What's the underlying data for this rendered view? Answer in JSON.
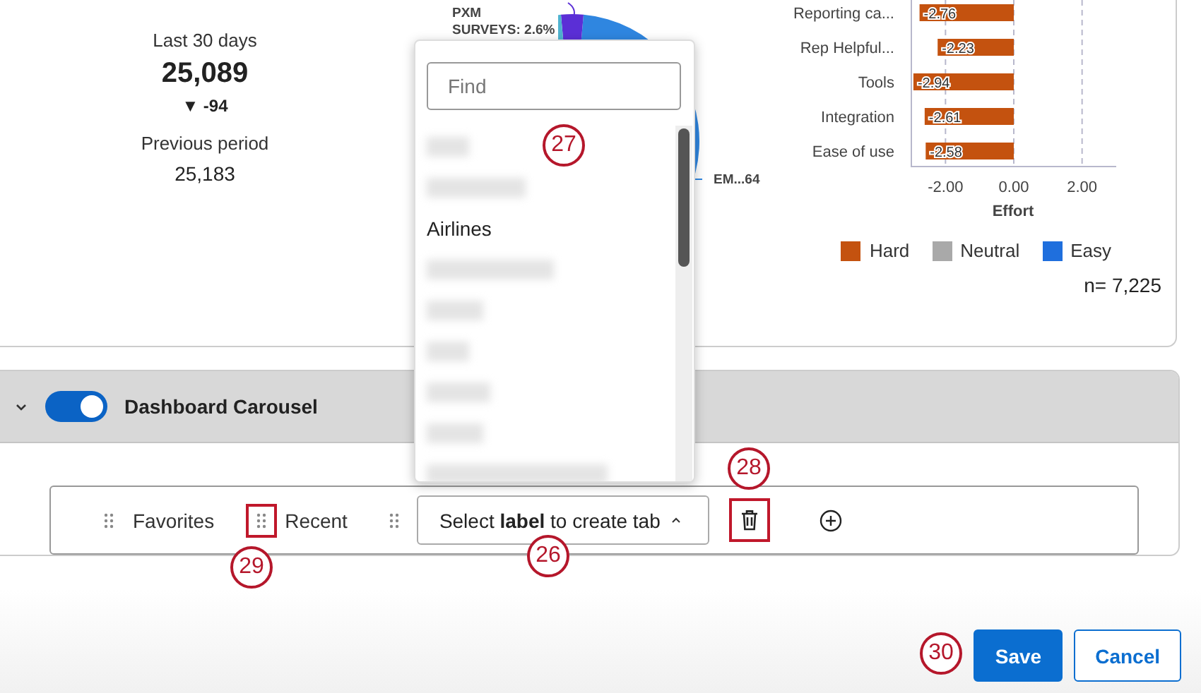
{
  "kpi": {
    "period_label": "Last 30 days",
    "value": "25,089",
    "change": {
      "text": "▼ -94"
    },
    "previous_label": "Previous period",
    "previous_value": "25,183"
  },
  "pie": {
    "labels": [
      {
        "lines": [
          "PXM",
          "SURVEYS: 2.6%"
        ]
      },
      {
        "lines": [
          "EM...64"
        ]
      }
    ]
  },
  "effort_chart": {
    "chart_data": {
      "type": "bar",
      "orientation": "horizontal",
      "xlabel": "Effort",
      "categories": [
        "Reporting ca...",
        "Rep Helpful...",
        "Tools",
        "Integration",
        "Ease of use"
      ],
      "series": [
        {
          "name": "Hard",
          "color": "#c4520f",
          "values": [
            -2.76,
            -2.23,
            -2.94,
            -2.61,
            -2.58
          ]
        },
        {
          "name": "Neutral",
          "color": "#a9a9a9",
          "values": [
            null,
            null,
            null,
            null,
            null
          ]
        },
        {
          "name": "Easy",
          "color": "#1f6fdd",
          "values": [
            null,
            null,
            null,
            null,
            null
          ]
        }
      ],
      "grid": true,
      "xlim": [
        -3,
        3
      ],
      "xticks": [
        {
          "value": -2,
          "label": "-2.00"
        },
        {
          "value": 0,
          "label": "0.00"
        },
        {
          "value": 2,
          "label": "2.00"
        }
      ],
      "data_labels": true
    },
    "n_label": "n= 7,225"
  },
  "dropdown": {
    "search": {
      "placeholder": "Find"
    },
    "items": [
      {
        "kind": "blurred"
      },
      {
        "kind": "blurred"
      },
      {
        "kind": "text",
        "label": "Airlines"
      },
      {
        "kind": "blurred"
      },
      {
        "kind": "blurred"
      },
      {
        "kind": "blurred"
      },
      {
        "kind": "blurred"
      },
      {
        "kind": "blurred"
      },
      {
        "kind": "blurred"
      }
    ]
  },
  "carousel": {
    "title": "Dashboard Carousel",
    "expanded": true,
    "enabled": true,
    "tabs": [
      {
        "label": "Favorites",
        "handle_highlighted": false
      },
      {
        "label": "Recent",
        "handle_highlighted": true
      }
    ],
    "select": {
      "handle_highlighted": false,
      "text": "Select **label** to create tab"
    },
    "delete_highlighted": true
  },
  "buttons": [
    {
      "kind": "primary",
      "label": "Save"
    },
    {
      "kind": "secondary",
      "label": "Cancel"
    }
  ],
  "callouts": [
    {
      "number": "27"
    },
    {
      "number": "28"
    },
    {
      "number": "26"
    },
    {
      "number": "29"
    },
    {
      "number": "30"
    }
  ]
}
